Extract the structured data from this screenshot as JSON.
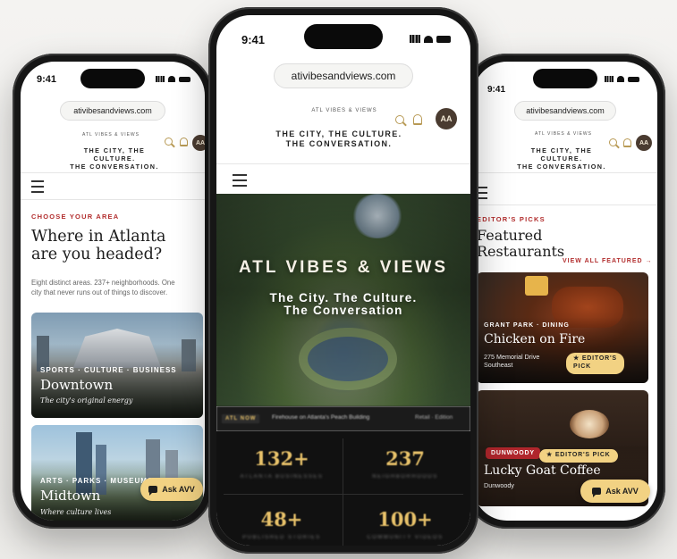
{
  "shared": {
    "time": "9:41",
    "url": "ativibesandviews.com",
    "logo_small": "ATL VIBES & VIEWS",
    "tagline_line1": "THE CITY, THE CULTURE.",
    "tagline_line2": "THE CONVERSATION.",
    "avatar_initials": "AA"
  },
  "left": {
    "eyebrow": "CHOOSE YOUR AREA",
    "heading_line1": "Where in Atlanta",
    "heading_line2": "are you headed?",
    "body_line1": "Eight distinct areas. 237+ neighborhoods. One",
    "body_line2": "city that never runs out of things to discover.",
    "cards": [
      {
        "meta": "SPORTS · CULTURE · BUSINESS",
        "title": "Downtown",
        "subtitle": "The city's original energy"
      },
      {
        "meta": "ARTS · PARKS · MUSEUMS",
        "title": "Midtown",
        "subtitle": "Where culture lives"
      }
    ],
    "ask_label": "Ask AVV"
  },
  "center": {
    "hero_title": "ATL VIBES & VIEWS",
    "hero_sub_line1": "The City. The Culture.",
    "hero_sub_line2": "The Conversation",
    "ticker_tag": "ATL NOW",
    "ticker_text": "Firehouse on Atlanta's Peach Building",
    "ticker_more": "Retail · Edition",
    "stats": [
      {
        "value": "132+",
        "label": "ATLANTA BUSINESSES"
      },
      {
        "value": "237",
        "label": "NEIGHBORHOODS"
      },
      {
        "value": "48+",
        "label": "PUBLISHED STORIES"
      },
      {
        "value": "100+",
        "label": "COMMUNITY VIDEOS"
      }
    ]
  },
  "right": {
    "eyebrow": "EDITOR'S PICKS",
    "heading_line1": "Featured",
    "heading_line2": "Restaurants",
    "view_all": "VIEW ALL FEATURED →",
    "cards": [
      {
        "meta": "GRANT PARK · DINING",
        "title": "Chicken on Fire",
        "address_line1": "275 Memorial Drive",
        "address_line2": "Southeast",
        "badge_line1": "★ EDITOR'S",
        "badge_line2": "PICK"
      },
      {
        "tag": "DUNWOODY",
        "badge": "★ EDITOR'S PICK",
        "title": "Lucky Goat Coffee",
        "address_line1": "Dunwoody"
      }
    ],
    "ask_label": "Ask AVV"
  }
}
